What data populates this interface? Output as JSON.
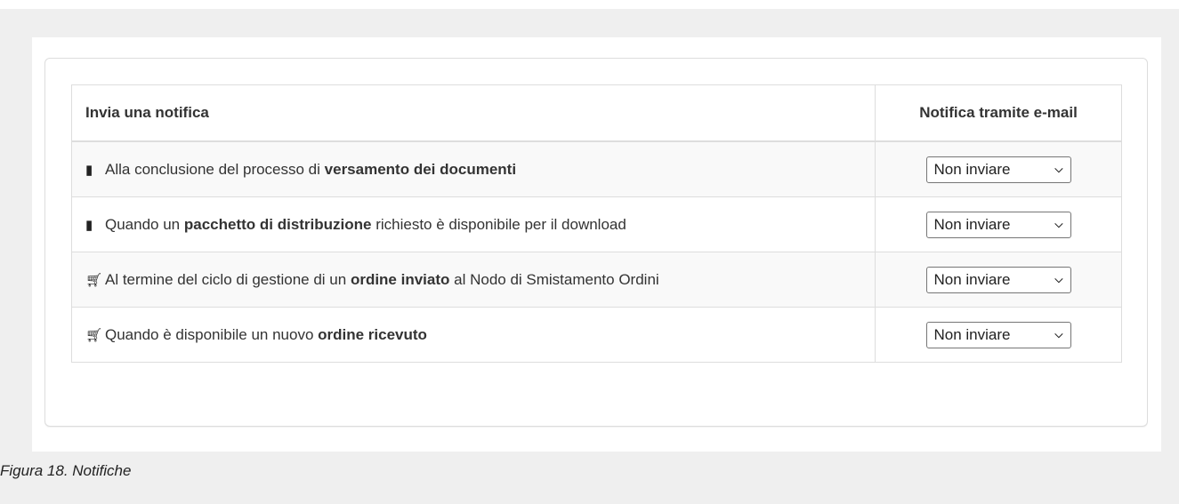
{
  "table": {
    "header": {
      "event": "Invia una notifica",
      "email": "Notifica tramite e-mail"
    },
    "rows": [
      {
        "icon": "book-icon",
        "glyph": "📘",
        "pre": "Alla conclusione del processo di ",
        "bold": "versamento dei documenti",
        "post": "",
        "email": "Non inviare"
      },
      {
        "icon": "book-icon",
        "glyph": "📘",
        "pre": "Quando un ",
        "bold": "pacchetto di distribuzione",
        "post": " richiesto è disponibile per il download",
        "email": "Non inviare"
      },
      {
        "icon": "shopping-cart-icon",
        "glyph": "🛒",
        "pre": "Al termine del ciclo di gestione di un ",
        "bold": "ordine inviato",
        "post": " al Nodo di Smistamento Ordini",
        "email": "Non inviare"
      },
      {
        "icon": "shopping-cart-icon",
        "glyph": "🛒",
        "pre": "Quando è disponibile un nuovo ",
        "bold": "ordine ricevuto",
        "post": "",
        "email": "Non inviare"
      }
    ]
  },
  "caption": "Figura 18. Notifiche"
}
